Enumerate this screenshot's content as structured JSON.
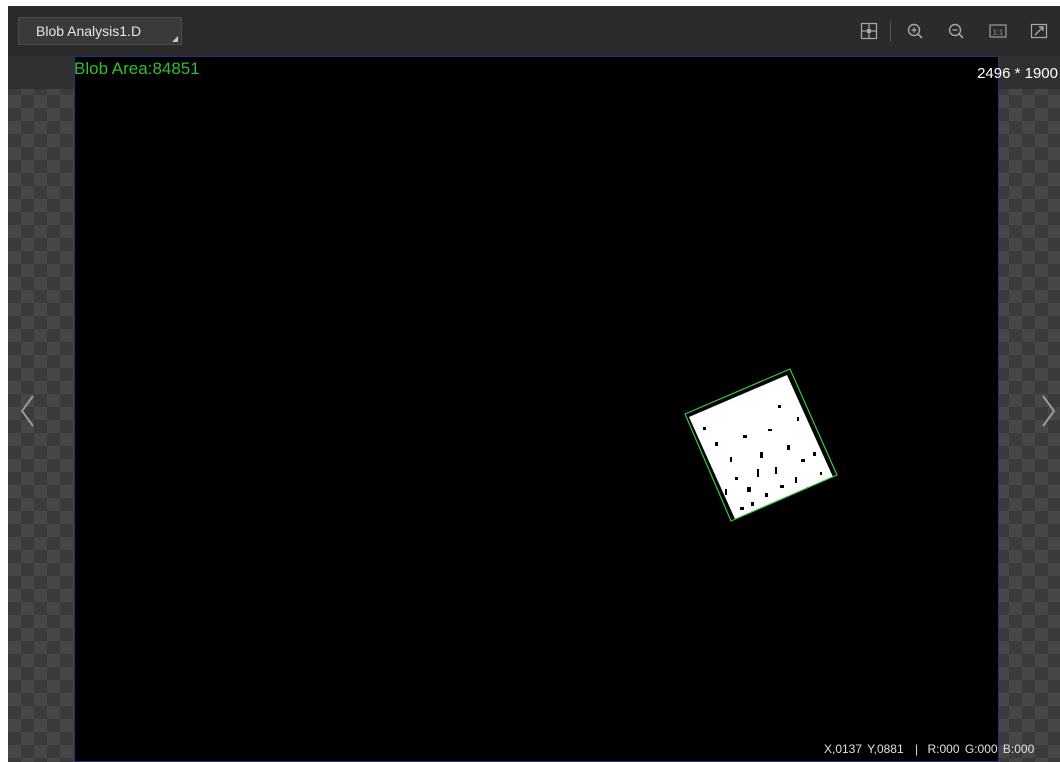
{
  "toolbar": {
    "image_source": "Blob Analysis1.D",
    "icons": [
      "grid-icon",
      "zoom-in-icon",
      "zoom-out-icon",
      "actual-size-icon",
      "fit-window-icon"
    ]
  },
  "overlay": {
    "blob_area_text": "Blob Area:84851",
    "image_size_text": "2496 * 1900"
  },
  "status_bar": {
    "x": "X,0137",
    "y": "Y,0881",
    "r": "R:000",
    "g": "G:000",
    "b": "B:000"
  },
  "colors": {
    "toolbar_bg": "#2b2b2b",
    "image_bg": "#000000",
    "blob_text": "#2fbf2f",
    "bounding_box": "#3cc83c",
    "image_border": "#2a2a8a"
  }
}
